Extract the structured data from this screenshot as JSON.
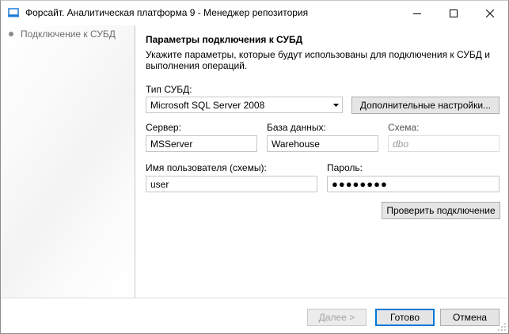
{
  "window": {
    "title": "Форсайт. Аналитическая платформа 9 - Менеджер репозитория"
  },
  "sidebar": {
    "steps": [
      {
        "label": "Подключение к СУБД",
        "active": true
      }
    ]
  },
  "content": {
    "title": "Параметры подключения к СУБД",
    "description": "Укажите параметры, которые будут использованы для подключения к СУБД и выполнения операций."
  },
  "form": {
    "dbms_type_label": "Тип СУБД:",
    "dbms_type_value": "Microsoft SQL Server 2008",
    "advanced_settings_button": "Дополнительные настройки...",
    "server_label": "Сервер:",
    "server_value": "MSServer",
    "database_label": "База данных:",
    "database_value": "Warehouse",
    "schema_label": "Схема:",
    "schema_placeholder": "dbo",
    "username_label": "Имя пользователя (схемы):",
    "username_value": "user",
    "password_label": "Пароль:",
    "password_value": "●●●●●●●●",
    "test_connection_button": "Проверить подключение"
  },
  "footer": {
    "next_button": "Далее >",
    "finish_button": "Готово",
    "cancel_button": "Отмена"
  },
  "colors": {
    "accent": "#0078d7",
    "app_icon": "#1e7bd6"
  }
}
